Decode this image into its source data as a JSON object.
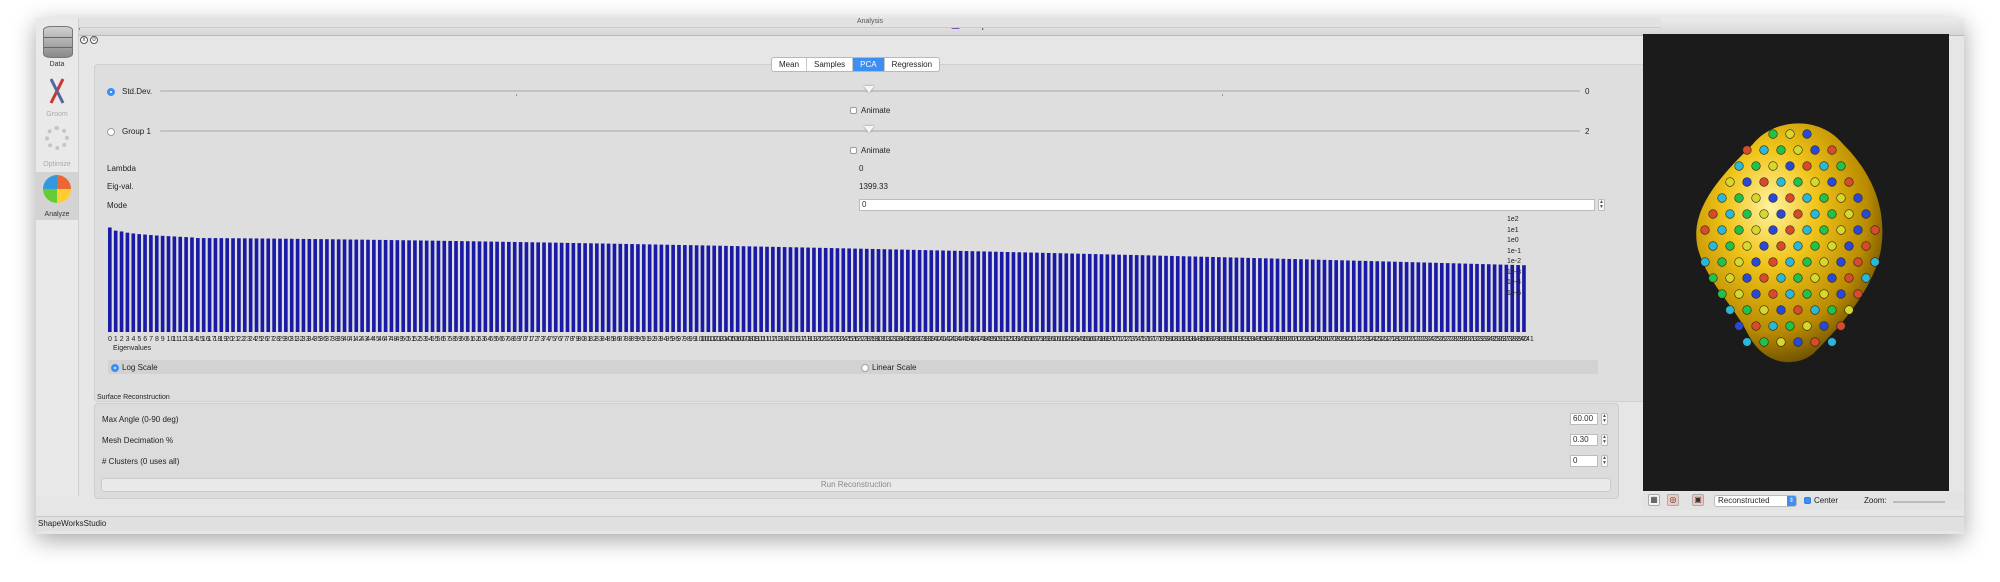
{
  "window": {
    "title": "ShapeWorksStudio",
    "panel_title": "Analysis"
  },
  "sidebar": {
    "items": [
      {
        "label": "Data"
      },
      {
        "label": "Groom"
      },
      {
        "label": "Optimize"
      },
      {
        "label": "Analyze"
      }
    ]
  },
  "tabs": [
    {
      "label": "Mean",
      "selected": false
    },
    {
      "label": "Samples",
      "selected": false
    },
    {
      "label": "PCA",
      "selected": true
    },
    {
      "label": "Regression",
      "selected": false
    }
  ],
  "pca": {
    "stddev_label": "Std.Dev.",
    "stddev_value": "0",
    "group_label": "Group 1",
    "group_value": "2",
    "animate_label": "Animate",
    "lambda_label": "Lambda",
    "lambda_value": "0",
    "eigval_label": "Eig-val.",
    "eigval_value": "1399.33",
    "mode_label": "Mode",
    "mode_value": "0",
    "stddev_slider_level": 0.5,
    "group_slider_level": 0.5
  },
  "scale": {
    "log_label": "Log Scale",
    "linear_label": "Linear Scale",
    "selected": "log"
  },
  "chart_data": {
    "type": "bar",
    "xlabel": "Eigenvalues",
    "yscale": "log",
    "ytick_labels": [
      "1e2",
      "1e1",
      "1e0",
      "1e-1",
      "1e-2",
      "1e-3",
      "1e-4",
      "1e-5"
    ],
    "ylim_exponent": [
      -5,
      2
    ],
    "bar_count": 242,
    "first_bar_exponents": [
      1.65,
      1.45,
      1.4,
      1.32,
      1.27,
      1.23,
      1.2,
      1.17,
      1.14,
      1.12,
      1.1,
      1.08,
      1.06,
      1.04,
      1.02
    ],
    "decay": {
      "start_exponent": 0.98,
      "end_exponent": -0.75
    },
    "color": "#1a1aa6"
  },
  "surface": {
    "section_label": "Surface Reconstruction",
    "max_angle_label": "Max Angle (0-90 deg)",
    "max_angle_value": "60.00",
    "decimation_label": "Mesh Decimation %",
    "decimation_value": "0.30",
    "clusters_label": "# Clusters (0 uses all)",
    "clusters_value": "0",
    "run_label": "Run Reconstruction"
  },
  "viewer": {
    "mode_value": "Reconstructed",
    "center_label": "Center",
    "center_checked": true,
    "zoom_label": "Zoom:"
  },
  "status": {
    "text": "ShapeWorksStudio"
  }
}
